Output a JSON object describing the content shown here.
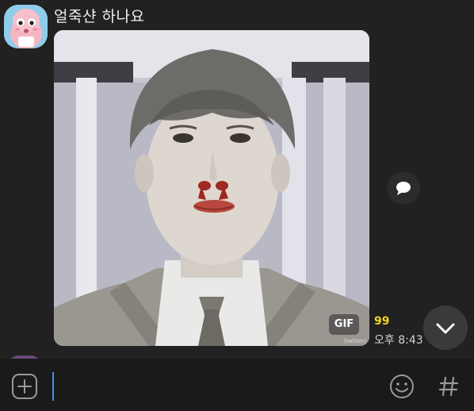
{
  "message": {
    "sender_name": "얼죽샨 하나요",
    "media_badge": "GIF",
    "watermark": "(twitter)",
    "unread_count": "99",
    "time": "오후 8:43"
  },
  "colors": {
    "background": "#212121",
    "input_bar": "#1a1a1a",
    "unread_accent": "#f2d21f",
    "caret": "#4a8fe8"
  },
  "icons": {
    "avatar": "peach-character-avatar",
    "reply": "speech-bubble-icon",
    "scroll_down": "chevron-down-icon",
    "add": "plus-square-icon",
    "emoji": "smiley-icon",
    "hash": "hash-icon"
  }
}
